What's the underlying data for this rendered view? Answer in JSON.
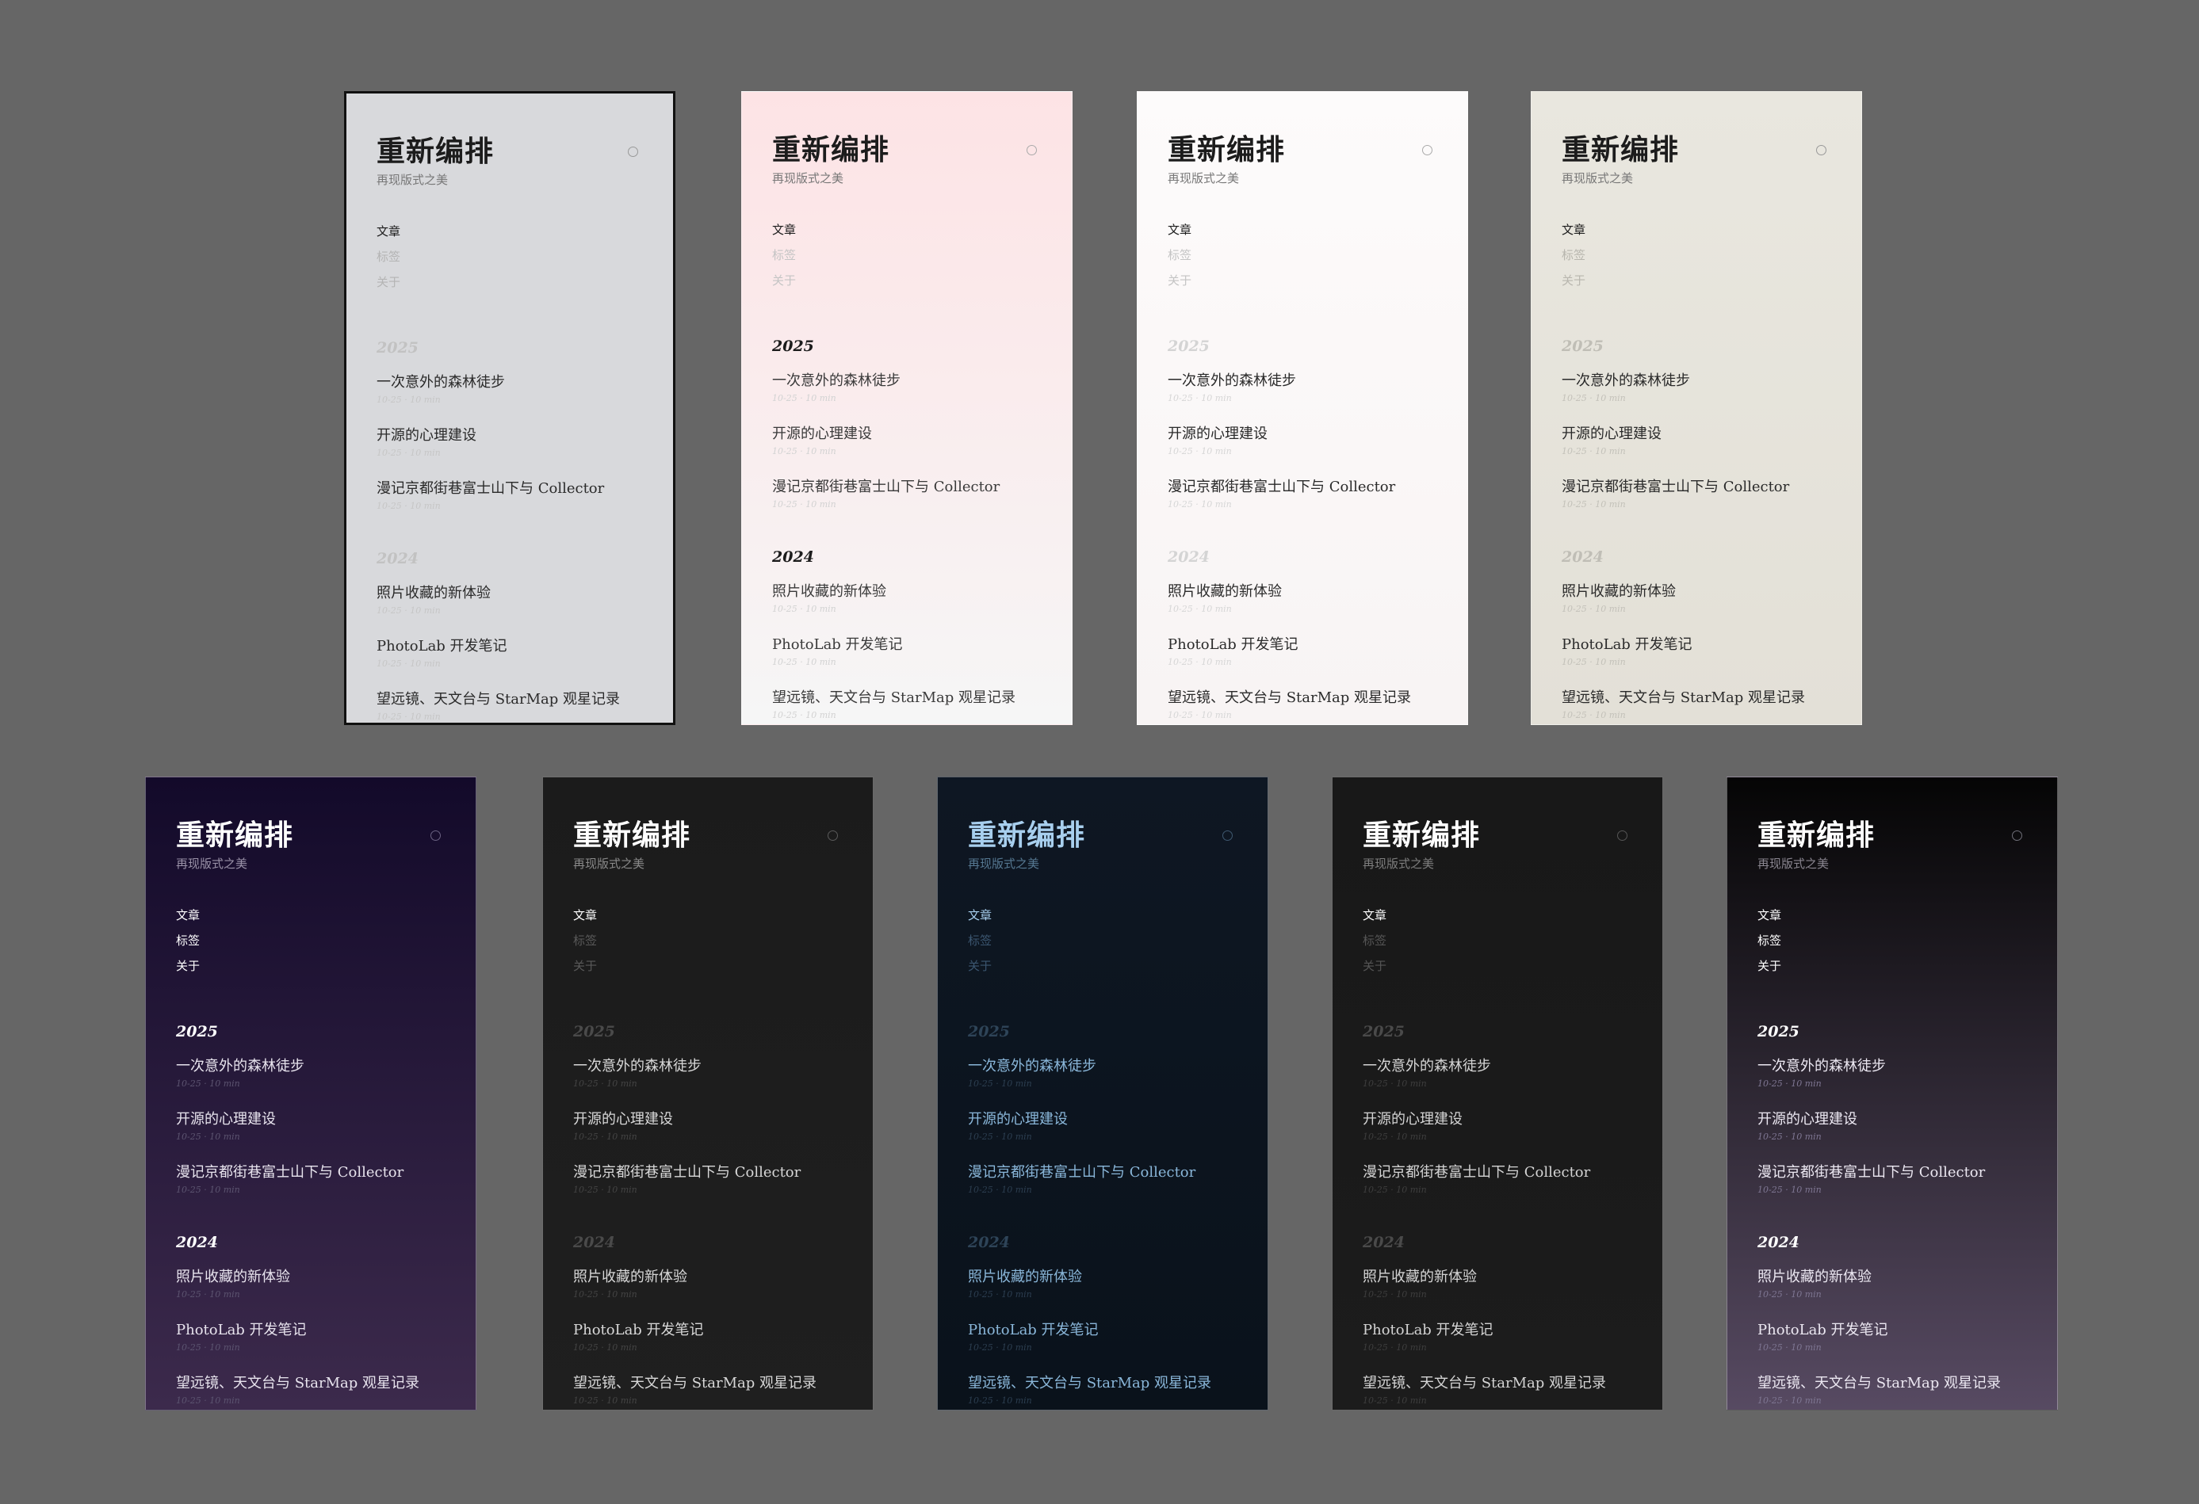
{
  "site": {
    "title": "重新编排",
    "subtitle": "再现版式之美"
  },
  "nav": [
    {
      "label": "文章"
    },
    {
      "label": "标签"
    },
    {
      "label": "关于"
    }
  ],
  "groups": [
    {
      "year": "2025",
      "posts": [
        {
          "title": "一次意外的森林徒步",
          "date": "10-25",
          "read": "10 min"
        },
        {
          "title": "开源的心理建设",
          "date": "10-25",
          "read": "10 min"
        },
        {
          "title": "漫记京都街巷富士山下与 Collector",
          "date": "10-25",
          "read": "10 min"
        }
      ]
    },
    {
      "year": "2024",
      "posts": [
        {
          "title": "照片收藏的新体验",
          "date": "10-25",
          "read": "10 min"
        },
        {
          "title": "PhotoLab 开发笔记",
          "date": "10-25",
          "read": "10 min"
        },
        {
          "title": "望远镜、天文台与 StarMap 观星记录",
          "date": "10-25",
          "read": "10 min"
        }
      ]
    }
  ],
  "themes": [
    {
      "id": "gray",
      "selected": true,
      "bg": "#d8d9dc",
      "bg2": "#d8d9dc",
      "title": "#1c1c1c",
      "sub": "#777777",
      "nav": "#1c1c1c",
      "navMuted": "#b4b4b4",
      "year": "#c2c2c2",
      "post": "#2a2a2a",
      "meta": "#c6c6c6",
      "toggle": "#999999"
    },
    {
      "id": "rose",
      "selected": false,
      "bg": "#fde3e5",
      "bg2": "#f6f6f6",
      "title": "#1c1c1c",
      "sub": "#777777",
      "nav": "#1c1c1c",
      "navMuted": "#c4c4c4",
      "year": "#1c1c1c",
      "post": "#3a3a3a",
      "meta": "#d2d2d2",
      "toggle": "#aaaaaa"
    },
    {
      "id": "white",
      "selected": false,
      "bg": "#fdfbfb",
      "bg2": "#f8f4f4",
      "title": "#1c1c1c",
      "sub": "#777777",
      "nav": "#1c1c1c",
      "navMuted": "#c4c4c4",
      "year": "#d4d4d4",
      "post": "#2a2a2a",
      "meta": "#d6d6d6",
      "toggle": "#aaaaaa"
    },
    {
      "id": "beige",
      "selected": false,
      "bg": "#e9e7df",
      "bg2": "#e3e0d7",
      "title": "#1c1c1c",
      "sub": "#777777",
      "nav": "#1c1c1c",
      "navMuted": "#b8b6ae",
      "year": "#c0beb6",
      "post": "#2a2a2a",
      "meta": "#c3c1b9",
      "toggle": "#999999"
    },
    {
      "id": "purple",
      "selected": false,
      "bg": "#130a2a",
      "bg2": "#3c2a4c",
      "title": "#ffffff",
      "sub": "#9a92a8",
      "nav": "#ffffff",
      "navMuted": "#ffffff",
      "year": "#ffffff",
      "post": "#e8e4ee",
      "meta": "#5c5470",
      "toggle": "#6a6282"
    },
    {
      "id": "charcoal",
      "selected": false,
      "bg": "#1b1b1b",
      "bg2": "#1f1f1f",
      "title": "#ffffff",
      "sub": "#8a8a8a",
      "nav": "#ffffff",
      "navMuted": "#595959",
      "year": "#4a4a4a",
      "post": "#d8d8d8",
      "meta": "#444444",
      "toggle": "#5a5a5a"
    },
    {
      "id": "navy",
      "selected": false,
      "bg": "#0e1723",
      "bg2": "#0a121b",
      "title": "#a8cfee",
      "sub": "#567892",
      "nav": "#a8cfee",
      "navMuted": "#3b5670",
      "year": "#2e4458",
      "post": "#8ab7da",
      "meta": "#2c3e50",
      "toggle": "#3f5870"
    },
    {
      "id": "black",
      "selected": false,
      "bg": "#181818",
      "bg2": "#1c1c1c",
      "title": "#ffffff",
      "sub": "#7e7e7e",
      "nav": "#ffffff",
      "navMuted": "#555555",
      "year": "#4a4a4a",
      "post": "#d4d4d4",
      "meta": "#3e3e3e",
      "toggle": "#555555"
    },
    {
      "id": "dusk",
      "selected": false,
      "bg": "#050505",
      "bg2": "#574a62",
      "title": "#ffffff",
      "sub": "#8a8690",
      "nav": "#ffffff",
      "navMuted": "#ffffff",
      "year": "#ffffff",
      "post": "#ece8f2",
      "meta": "#7e7692",
      "toggle": "#6e6e78"
    }
  ]
}
